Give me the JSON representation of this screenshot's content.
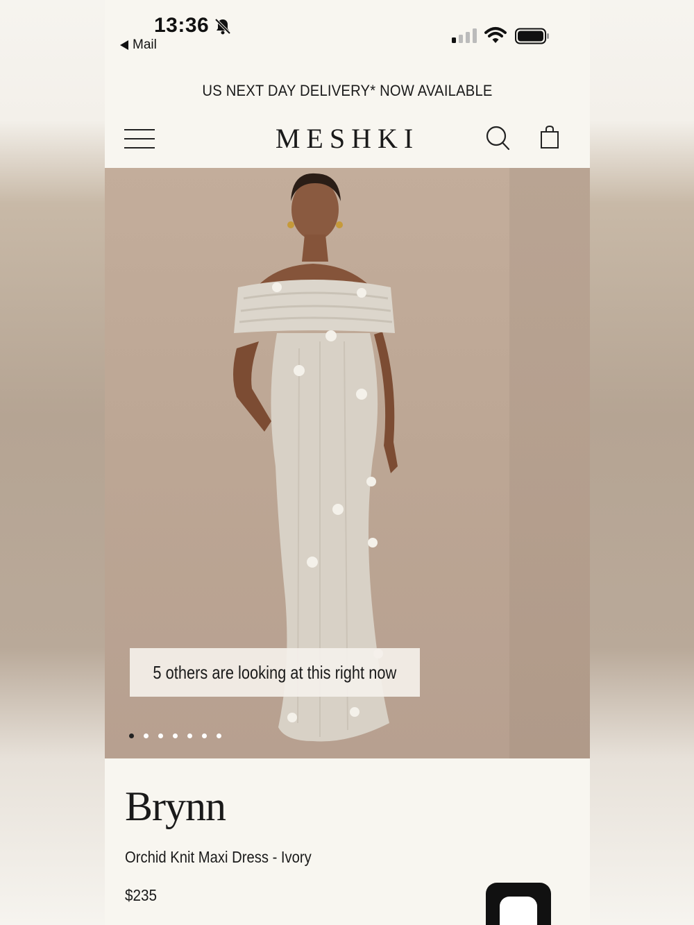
{
  "status_bar": {
    "time": "13:36",
    "back_label": "Mail",
    "icons": [
      "bell-slash-icon",
      "signal-icon",
      "wifi-icon",
      "battery-icon"
    ]
  },
  "promo": {
    "text": "US NEXT DAY DELIVERY* NOW AVAILABLE"
  },
  "header": {
    "brand": "MESHKI",
    "icons": [
      "menu-icon",
      "search-icon",
      "shopping-bag-icon"
    ]
  },
  "gallery": {
    "viewers_banner": "5 others are looking at this right now",
    "slide_count": 7,
    "active_slide": 1
  },
  "product": {
    "name": "Brynn",
    "subtitle": "Orchid Knit Maxi Dress - Ivory",
    "price": "$235"
  },
  "colors": {
    "page_background": "#f8f6f0",
    "hero_background": "#c0aa98",
    "text": "#1a1a1a",
    "chat_button": "#111111"
  }
}
